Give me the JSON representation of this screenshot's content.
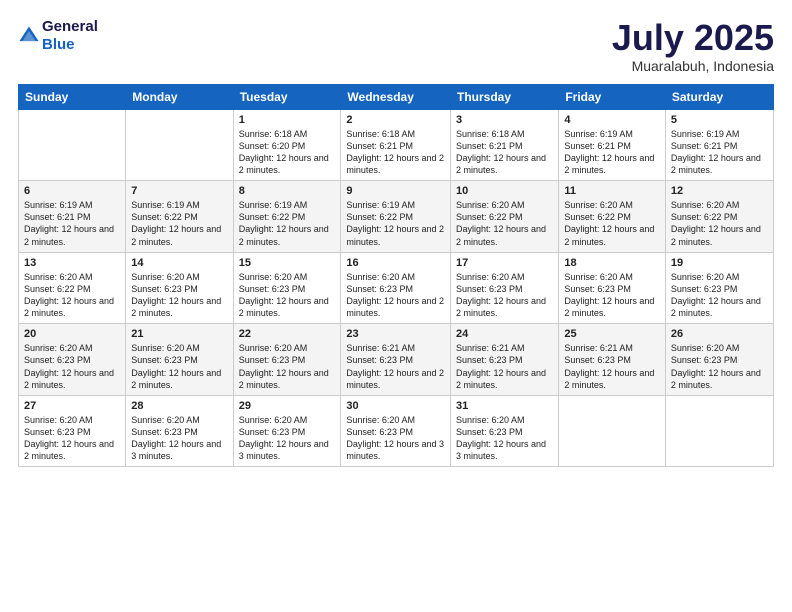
{
  "logo": {
    "general": "General",
    "blue": "Blue"
  },
  "header": {
    "month": "July 2025",
    "location": "Muaralabuh, Indonesia"
  },
  "weekdays": [
    "Sunday",
    "Monday",
    "Tuesday",
    "Wednesday",
    "Thursday",
    "Friday",
    "Saturday"
  ],
  "weeks": [
    [
      {
        "day": "",
        "info": ""
      },
      {
        "day": "",
        "info": ""
      },
      {
        "day": "1",
        "info": "Sunrise: 6:18 AM\nSunset: 6:20 PM\nDaylight: 12 hours\nand 2 minutes."
      },
      {
        "day": "2",
        "info": "Sunrise: 6:18 AM\nSunset: 6:21 PM\nDaylight: 12 hours\nand 2 minutes."
      },
      {
        "day": "3",
        "info": "Sunrise: 6:18 AM\nSunset: 6:21 PM\nDaylight: 12 hours\nand 2 minutes."
      },
      {
        "day": "4",
        "info": "Sunrise: 6:19 AM\nSunset: 6:21 PM\nDaylight: 12 hours\nand 2 minutes."
      },
      {
        "day": "5",
        "info": "Sunrise: 6:19 AM\nSunset: 6:21 PM\nDaylight: 12 hours\nand 2 minutes."
      }
    ],
    [
      {
        "day": "6",
        "info": "Sunrise: 6:19 AM\nSunset: 6:21 PM\nDaylight: 12 hours\nand 2 minutes."
      },
      {
        "day": "7",
        "info": "Sunrise: 6:19 AM\nSunset: 6:22 PM\nDaylight: 12 hours\nand 2 minutes."
      },
      {
        "day": "8",
        "info": "Sunrise: 6:19 AM\nSunset: 6:22 PM\nDaylight: 12 hours\nand 2 minutes."
      },
      {
        "day": "9",
        "info": "Sunrise: 6:19 AM\nSunset: 6:22 PM\nDaylight: 12 hours\nand 2 minutes."
      },
      {
        "day": "10",
        "info": "Sunrise: 6:20 AM\nSunset: 6:22 PM\nDaylight: 12 hours\nand 2 minutes."
      },
      {
        "day": "11",
        "info": "Sunrise: 6:20 AM\nSunset: 6:22 PM\nDaylight: 12 hours\nand 2 minutes."
      },
      {
        "day": "12",
        "info": "Sunrise: 6:20 AM\nSunset: 6:22 PM\nDaylight: 12 hours\nand 2 minutes."
      }
    ],
    [
      {
        "day": "13",
        "info": "Sunrise: 6:20 AM\nSunset: 6:22 PM\nDaylight: 12 hours\nand 2 minutes."
      },
      {
        "day": "14",
        "info": "Sunrise: 6:20 AM\nSunset: 6:23 PM\nDaylight: 12 hours\nand 2 minutes."
      },
      {
        "day": "15",
        "info": "Sunrise: 6:20 AM\nSunset: 6:23 PM\nDaylight: 12 hours\nand 2 minutes."
      },
      {
        "day": "16",
        "info": "Sunrise: 6:20 AM\nSunset: 6:23 PM\nDaylight: 12 hours\nand 2 minutes."
      },
      {
        "day": "17",
        "info": "Sunrise: 6:20 AM\nSunset: 6:23 PM\nDaylight: 12 hours\nand 2 minutes."
      },
      {
        "day": "18",
        "info": "Sunrise: 6:20 AM\nSunset: 6:23 PM\nDaylight: 12 hours\nand 2 minutes."
      },
      {
        "day": "19",
        "info": "Sunrise: 6:20 AM\nSunset: 6:23 PM\nDaylight: 12 hours\nand 2 minutes."
      }
    ],
    [
      {
        "day": "20",
        "info": "Sunrise: 6:20 AM\nSunset: 6:23 PM\nDaylight: 12 hours\nand 2 minutes."
      },
      {
        "day": "21",
        "info": "Sunrise: 6:20 AM\nSunset: 6:23 PM\nDaylight: 12 hours\nand 2 minutes."
      },
      {
        "day": "22",
        "info": "Sunrise: 6:20 AM\nSunset: 6:23 PM\nDaylight: 12 hours\nand 2 minutes."
      },
      {
        "day": "23",
        "info": "Sunrise: 6:21 AM\nSunset: 6:23 PM\nDaylight: 12 hours\nand 2 minutes."
      },
      {
        "day": "24",
        "info": "Sunrise: 6:21 AM\nSunset: 6:23 PM\nDaylight: 12 hours\nand 2 minutes."
      },
      {
        "day": "25",
        "info": "Sunrise: 6:21 AM\nSunset: 6:23 PM\nDaylight: 12 hours\nand 2 minutes."
      },
      {
        "day": "26",
        "info": "Sunrise: 6:20 AM\nSunset: 6:23 PM\nDaylight: 12 hours\nand 2 minutes."
      }
    ],
    [
      {
        "day": "27",
        "info": "Sunrise: 6:20 AM\nSunset: 6:23 PM\nDaylight: 12 hours\nand 2 minutes."
      },
      {
        "day": "28",
        "info": "Sunrise: 6:20 AM\nSunset: 6:23 PM\nDaylight: 12 hours\nand 3 minutes."
      },
      {
        "day": "29",
        "info": "Sunrise: 6:20 AM\nSunset: 6:23 PM\nDaylight: 12 hours\nand 3 minutes."
      },
      {
        "day": "30",
        "info": "Sunrise: 6:20 AM\nSunset: 6:23 PM\nDaylight: 12 hours\nand 3 minutes."
      },
      {
        "day": "31",
        "info": "Sunrise: 6:20 AM\nSunset: 6:23 PM\nDaylight: 12 hours\nand 3 minutes."
      },
      {
        "day": "",
        "info": ""
      },
      {
        "day": "",
        "info": ""
      }
    ]
  ]
}
